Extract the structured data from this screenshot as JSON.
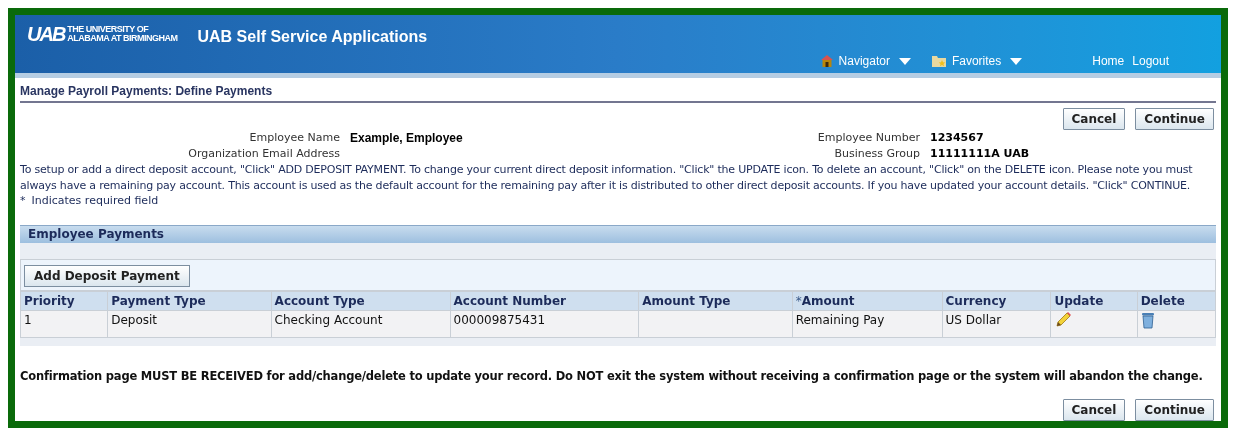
{
  "header": {
    "logo_mark": "UAB",
    "logo_text": [
      "THE UNIVERSITY OF",
      "ALABAMA AT BIRMINGHAM"
    ],
    "title": "UAB Self Service Applications",
    "menus": [
      {
        "label": "Navigator",
        "kind": "house"
      },
      {
        "label": "Favorites",
        "kind": "folder"
      }
    ],
    "links": [
      "Home",
      "Logout"
    ]
  },
  "page_title": "Manage Payroll Payments: Define Payments",
  "actions": [
    "Cancel",
    "Continue"
  ],
  "employee": {
    "left": [
      {
        "label": "Employee Name",
        "value": "Example, Employee"
      },
      {
        "label": "Organization Email Address"
      }
    ],
    "right": [
      {
        "label": "Employee Number",
        "value": "1234567"
      },
      {
        "label": "Business Group",
        "value": "11111111A UAB"
      }
    ]
  },
  "instructions": "To setup or add a direct deposit account, \"Click\" ADD DEPOSIT PAYMENT. To change your current direct deposit information. \"Click\" the UPDATE icon. To delete an account, \"Click\" on the DELETE icon. Please note you must always have a remaining pay account. This account is used as the default account for the remaining pay after it is distributed to other direct deposit accounts. If you have updated your account details. \"Click\" CONTINUE.",
  "required_note": {
    "mark": "*",
    "text": "Indicates required field"
  },
  "section": {
    "title": "Employee Payments",
    "add_button": "Add Deposit Payment",
    "columns": [
      {
        "label": "Priority",
        "required": false
      },
      {
        "label": "Payment Type",
        "required": false
      },
      {
        "label": "Account Type",
        "required": false
      },
      {
        "label": "Account Number",
        "required": false
      },
      {
        "label": "Amount Type",
        "required": false
      },
      {
        "label": "Amount",
        "required": true
      },
      {
        "label": "Currency",
        "required": false
      },
      {
        "label": "Update",
        "required": false
      },
      {
        "label": "Delete",
        "required": false
      }
    ],
    "rows": [
      {
        "priority": "1",
        "payment_type": "Deposit",
        "account_type": "Checking Account",
        "account_number": "000009875431",
        "amount": "Remaining Pay",
        "currency": "US Dollar"
      }
    ]
  },
  "confirmation": "Confirmation page MUST BE RECEIVED for add/change/delete to update your record. Do NOT exit the system without receiving a confirmation page or the system will abandon the change.",
  "bottom_actions": [
    "Cancel",
    "Continue"
  ]
}
